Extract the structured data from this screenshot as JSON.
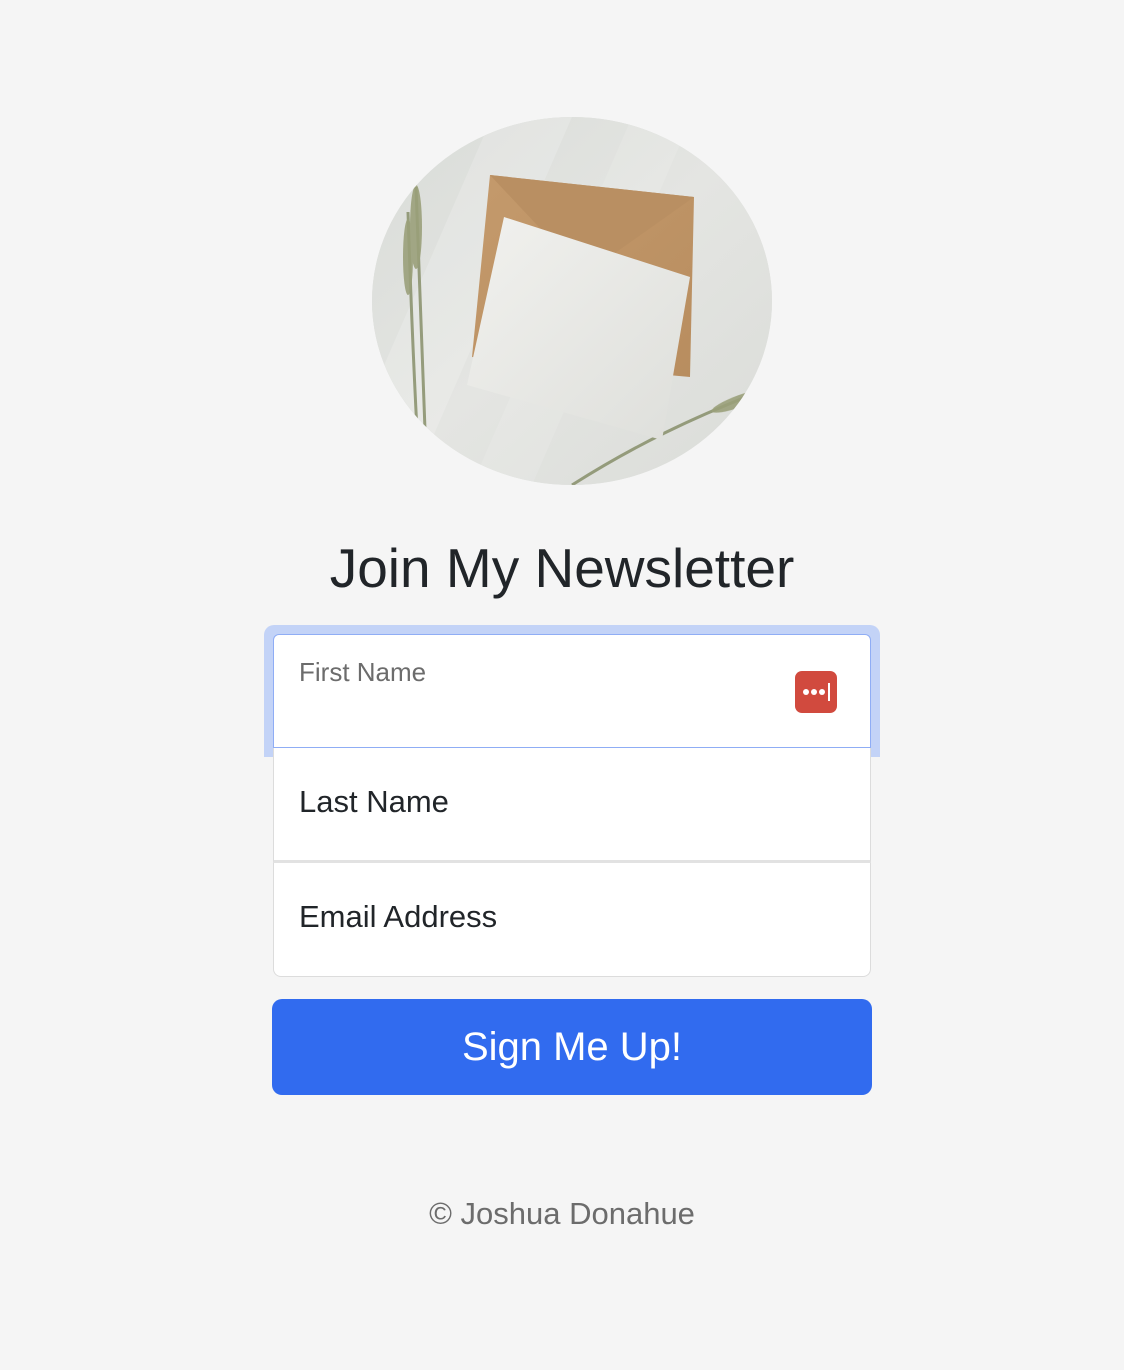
{
  "hero": {
    "image": "envelope-with-card-and-wheat-photo"
  },
  "heading": "Join My Newsletter",
  "form": {
    "first_name": {
      "label": "First Name",
      "value": "",
      "focused": true,
      "autofill_icon": "password-manager-icon",
      "autofill_icon_color": "#d14a3e"
    },
    "last_name": {
      "placeholder": "Last Name",
      "value": ""
    },
    "email": {
      "placeholder": "Email Address",
      "value": ""
    },
    "submit_label": "Sign Me Up!"
  },
  "footer": {
    "copyright": "© Joshua Donahue"
  },
  "colors": {
    "background": "#f5f5f5",
    "primary_button": "#316bef",
    "focus_ring": "#c3d3f7",
    "text": "#212529",
    "muted_text": "#6c6c6c"
  }
}
